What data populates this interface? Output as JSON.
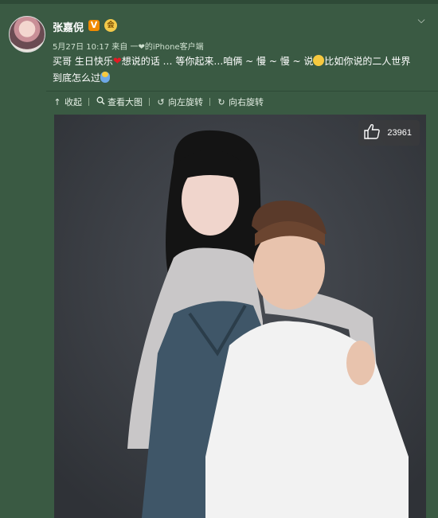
{
  "post": {
    "author": "张嘉倪",
    "vip_badge": "V",
    "crown_badge": "会",
    "meta": {
      "date": "5月27日 10:17",
      "source_prefix": "来自",
      "source": "一❤的iPhone客户端"
    },
    "content": {
      "part1": "买哥 生日快乐",
      "part2": "想说的话 … 等你起来…咱俩 ~ 慢 ~ 慢 ~ 说",
      "part3": "比如你说的二人世界 到底怎么过"
    },
    "actions": {
      "collapse": "收起",
      "view_large": "查看大图",
      "rotate_left": "向左旋转",
      "rotate_right": "向右旋转"
    },
    "photo": {
      "like_count": "23961"
    }
  },
  "icons": {
    "collapse": "arrow-up-icon",
    "view_large": "magnifier-icon",
    "rotate_left": "rotate-left-icon",
    "rotate_right": "rotate-right-icon",
    "like": "thumbs-up-icon",
    "menu": "chevron-down-icon"
  }
}
